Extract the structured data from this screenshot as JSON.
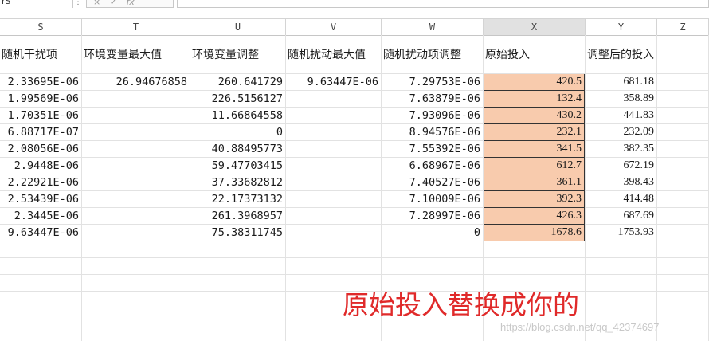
{
  "formula_bar": {
    "name_box": "rS",
    "fx_label": "fx",
    "cancel_glyph": "×",
    "confirm_glyph": "✓"
  },
  "columns": [
    "S",
    "T",
    "U",
    "V",
    "W",
    "X",
    "Y",
    "Z"
  ],
  "headers": {
    "S": "随机干扰项",
    "T": "环境变量最大值",
    "U": "环境变量调整",
    "V": "随机扰动最大值",
    "W": "随机扰动项调整",
    "X": "原始投入",
    "Y": "调整后的投入"
  },
  "rows": [
    {
      "S": "2.33695E-06",
      "T": "26.94676858",
      "U": "260.641729",
      "V": "9.63447E-06",
      "W": "7.29753E-06",
      "X": "420.5",
      "Y": "681.18"
    },
    {
      "S": "1.99569E-06",
      "T": "",
      "U": "226.5156127",
      "V": "",
      "W": "7.63879E-06",
      "X": "132.4",
      "Y": "358.89"
    },
    {
      "S": "1.70351E-06",
      "T": "",
      "U": "11.66864558",
      "V": "",
      "W": "7.93096E-06",
      "X": "430.2",
      "Y": "441.83"
    },
    {
      "S": "6.88717E-07",
      "T": "",
      "U": "0",
      "V": "",
      "W": "8.94576E-06",
      "X": "232.1",
      "Y": "232.09"
    },
    {
      "S": "2.08056E-06",
      "T": "",
      "U": "40.88495773",
      "V": "",
      "W": "7.55392E-06",
      "X": "341.5",
      "Y": "382.35"
    },
    {
      "S": "2.9448E-06",
      "T": "",
      "U": "59.47703415",
      "V": "",
      "W": "6.68967E-06",
      "X": "612.7",
      "Y": "672.19"
    },
    {
      "S": "2.22921E-06",
      "T": "",
      "U": "37.33682812",
      "V": "",
      "W": "7.40527E-06",
      "X": "361.1",
      "Y": "398.43"
    },
    {
      "S": "2.53439E-06",
      "T": "",
      "U": "22.17373132",
      "V": "",
      "W": "7.10009E-06",
      "X": "392.3",
      "Y": "414.48"
    },
    {
      "S": "2.3445E-06",
      "T": "",
      "U": "261.3968957",
      "V": "",
      "W": "7.28997E-06",
      "X": "426.3",
      "Y": "687.69"
    },
    {
      "S": "9.63447E-06",
      "T": "",
      "U": "75.38311745",
      "V": "",
      "W": "0",
      "X": "1678.6",
      "Y": "1753.93"
    }
  ],
  "annotation": "原始投入替换成你的",
  "watermark": "https://blog.csdn.net/qq_42374697",
  "colors": {
    "highlight": "#f8cbad",
    "annotation": "#e02a2a"
  }
}
